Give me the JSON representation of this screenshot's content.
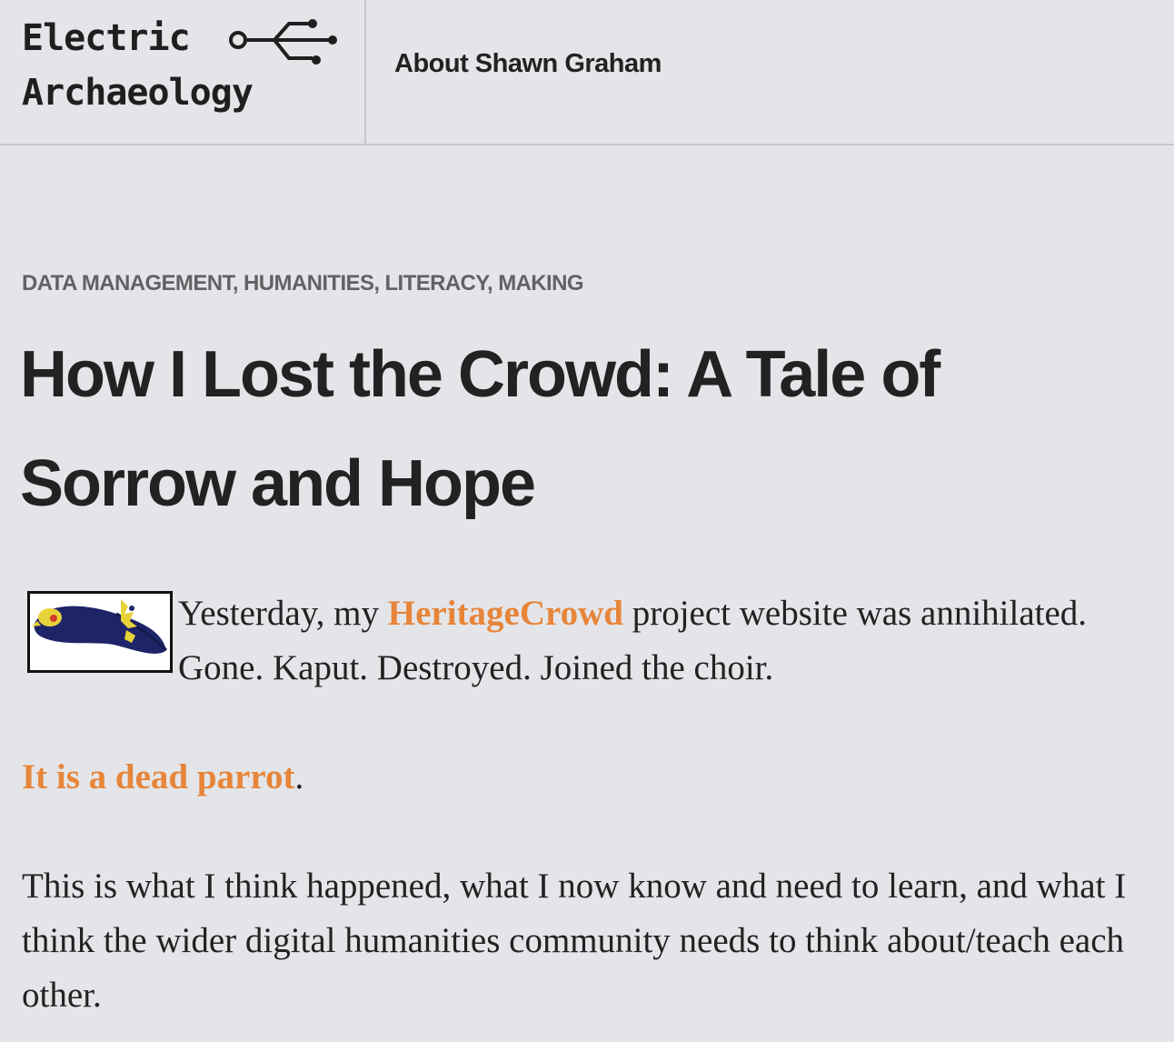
{
  "site": {
    "logo_line1": "Electric",
    "logo_line2": "Archaeology",
    "nav": [
      {
        "label": "About Shawn Graham"
      }
    ]
  },
  "post": {
    "categories": [
      "DATA MANAGEMENT",
      "HUMANITIES",
      "LITERACY",
      "MAKING"
    ],
    "category_separator": ", ",
    "title": "How I Lost the Crowd: A Tale of Sorrow and Hope",
    "paragraph1": {
      "before": "Yesterday, my ",
      "link": "HeritageCrowd",
      "after": " project website was annihilated. Gone. Kaput. Destroyed. Joined the choir."
    },
    "paragraph2": {
      "link": "It is a dead parrot",
      "after": "."
    },
    "paragraph3": "This is what I think happened, what I now know and need to learn, and what I think the wider digital humanities community needs to think about/teach each other."
  },
  "colors": {
    "background": "#e4e5e8",
    "link": "#e7853a",
    "category": "#606264",
    "text": "#222222"
  },
  "icons": {
    "logo_glyph": "usb-connector-icon",
    "post_thumbnail": "dead-parrot-image"
  }
}
